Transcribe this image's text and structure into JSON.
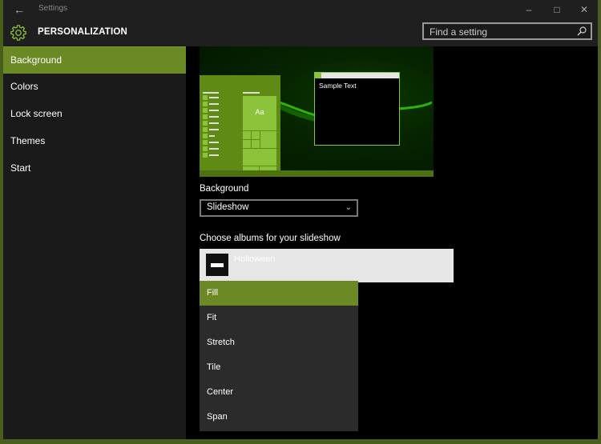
{
  "window": {
    "app_title": "Settings",
    "back_icon": "back-arrow-icon",
    "controls": [
      "minimize",
      "maximize",
      "close"
    ]
  },
  "header": {
    "icon": "gear-icon",
    "title": "PERSONALIZATION",
    "search_placeholder": "Find a setting"
  },
  "sidebar": {
    "items": [
      {
        "label": "Background",
        "active": true
      },
      {
        "label": "Colors",
        "active": false
      },
      {
        "label": "Lock screen",
        "active": false
      },
      {
        "label": "Themes",
        "active": false
      },
      {
        "label": "Start",
        "active": false
      }
    ]
  },
  "main": {
    "preview": {
      "tile_label": "Aa",
      "sample_text": "Sample Text"
    },
    "background_label": "Background",
    "background_value": "Slideshow",
    "albums_label": "Choose albums for your slideshow",
    "album_name": "Holloween",
    "fit_options": [
      {
        "label": "Fill",
        "selected": true
      },
      {
        "label": "Fit",
        "selected": false
      },
      {
        "label": "Stretch",
        "selected": false
      },
      {
        "label": "Tile",
        "selected": false
      },
      {
        "label": "Center",
        "selected": false
      },
      {
        "label": "Span",
        "selected": false
      }
    ]
  },
  "colors": {
    "accent": "#6b8a26",
    "accent_light": "#8bc43a",
    "frame": "#4a5e1c"
  }
}
